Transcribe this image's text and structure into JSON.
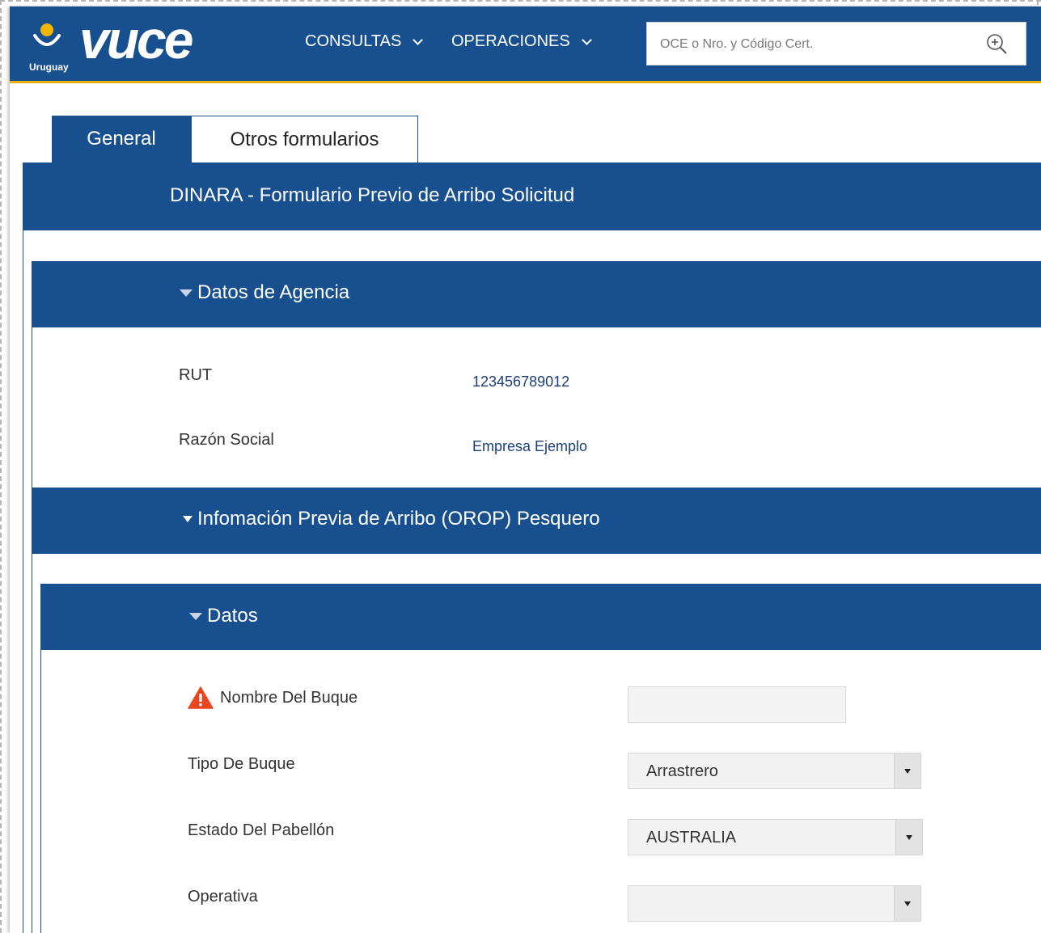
{
  "header": {
    "logo_country": "Uruguay",
    "logo_word": "vuce",
    "nav": [
      {
        "label": "CONSULTAS"
      },
      {
        "label": "OPERACIONES"
      }
    ],
    "search": {
      "placeholder": "OCE o Nro. y Código Cert."
    }
  },
  "tabs": [
    {
      "label": "General",
      "active": true
    },
    {
      "label": "Otros formularios",
      "active": false
    }
  ],
  "form_title": "DINARA - Formulario Previo de Arribo Solicitud",
  "sections": {
    "agencia": {
      "title": "Datos de Agencia",
      "rut_label": "RUT",
      "rut_value": "123456789012",
      "razon_label": "Razón Social",
      "razon_value": "Empresa Ejemplo"
    },
    "orop": {
      "title": "Infomación Previa de Arribo (OROP) Pesquero"
    },
    "datos": {
      "title": "Datos",
      "nombre_buque_label": "Nombre Del Buque",
      "nombre_buque_value": "",
      "tipo_buque_label": "Tipo De Buque",
      "tipo_buque_value": "Arrastrero",
      "estado_pabellon_label": "Estado Del Pabellón",
      "estado_pabellon_value": "AUSTRALIA",
      "operativa_label": "Operativa",
      "operativa_value": ""
    }
  },
  "colors": {
    "brand_blue": "#174f8f",
    "accent_yellow": "#e7b10a",
    "warning_orange": "#e8461e",
    "value_text": "#1c3e78"
  },
  "icons": [
    "logo-sun-icon",
    "chevron-down-icon",
    "search-zoom-icon",
    "triangle-collapse-icon",
    "warning-icon",
    "select-arrow-icon"
  ]
}
